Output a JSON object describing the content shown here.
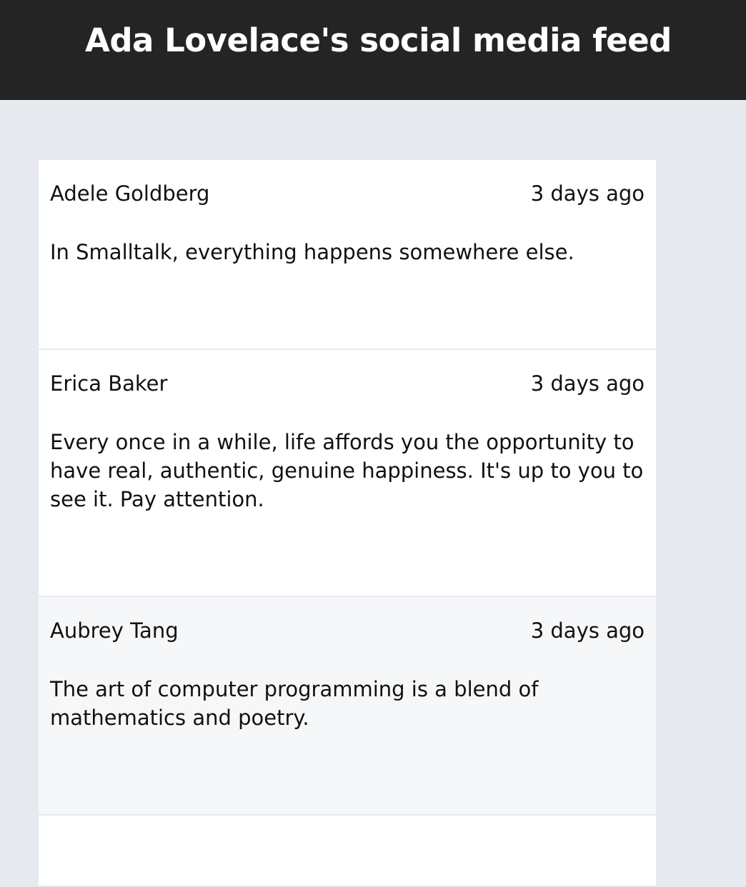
{
  "header": {
    "title": "Ada Lovelace's social media feed"
  },
  "posts": [
    {
      "author": "Adele Goldberg",
      "time": "3 days ago",
      "text": "In Smalltalk, everything happens somewhere else."
    },
    {
      "author": "Erica Baker",
      "time": "3 days ago",
      "text": "Every once in a while, life affords you the opportunity to have real, authentic, genuine happiness. It's up to you to see it. Pay attention."
    },
    {
      "author": "Aubrey Tang",
      "time": "3 days ago",
      "text": "The art of computer programming is a blend of mathematics and poetry."
    }
  ]
}
